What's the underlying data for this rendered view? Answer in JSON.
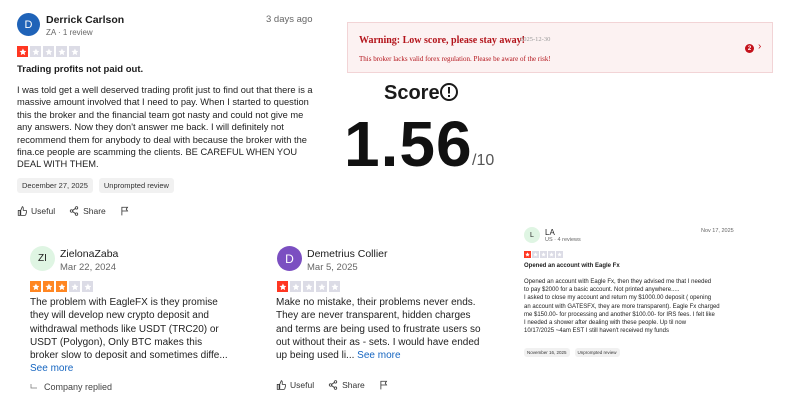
{
  "colors": {
    "star_filled": "#ff3722",
    "star_orange": "#ff8622",
    "star_empty": "#dcdce6",
    "warning": "#b3141b",
    "link": "#1565c0"
  },
  "review1": {
    "avatar": "D",
    "avatar_color": "#1f63b8",
    "name": "Derrick Carlson",
    "meta": "ZA · 1 review",
    "date": "3 days ago",
    "rating": 1,
    "title": "Trading profits not paid out.",
    "body": "I was told get a well deserved trading profit just to find out that there is a massive amount involved that I need to pay. When I started to question this the broker and the financial team got nasty and could not give me any answers. Now they don't answer me back. I will definitely not recommend them for anybody to deal with because the broker with the fina.ce people are scamming the clients. BE CAREFUL WHEN YOU DEAL WITH THEM.",
    "tags": [
      "December 27, 2025",
      "Unprompted review"
    ],
    "actions": {
      "useful": "Useful",
      "share": "Share"
    }
  },
  "warning": {
    "title": "Warning: Low score, please stay away!",
    "date": "2025-12-30",
    "text": "This broker lacks valid forex regulation. Please be aware of the risk!",
    "badge": "2"
  },
  "score": {
    "label": "Score",
    "value": "1.56",
    "max": "/10"
  },
  "review2": {
    "avatar": "ZI",
    "avatar_color": "#dff5e3",
    "name": "ZielonaZaba",
    "date": "Mar 22, 2024",
    "rating": 3,
    "body": "The problem with EagleFX is they promise they will develop new crypto deposit and withdrawal methods like USDT (TRC20) or USDT (Polygon), Only BTC makes this broker slow to deposit and sometimes diffe...",
    "see_more": "See more",
    "company_replied": "Company replied"
  },
  "review3": {
    "avatar": "D",
    "avatar_color": "#7b4fc1",
    "name": "Demetrius Collier",
    "date": "Mar 5, 2025",
    "rating": 1,
    "body": "Make no mistake, their problems never ends. They are never transparent, hidden charges and terms are being used to frustrate users so out without their as - sets. I would have ended up being used li...",
    "see_more": "See more",
    "actions": {
      "useful": "Useful",
      "share": "Share"
    }
  },
  "review4": {
    "avatar": "L",
    "avatar_color": "#dff5e3",
    "name": "LA",
    "meta": "US · 4 reviews",
    "date": "Nov 17, 2025",
    "rating": 1,
    "title": "Opened an account with Eagle Fx",
    "body_lines": [
      "Opened an account with Eagle Fx, then they advised me that I needed",
      "to pay $2000 for a basic account. Not printed anywhere.....",
      "I asked to close my account and return my $1000.00 deposit ( opening",
      "an account with GATESFX, they are more transparent). Eagle Fx charged",
      "me $150.00- for processing and another $100.00- for IRS fees. I felt like",
      "I needed a shower after dealing with these people. Up til now",
      "10/17/2025 ~4am EST I still haven't received my funds"
    ],
    "tags": [
      "November 16, 2025",
      "Unprompted review"
    ]
  }
}
